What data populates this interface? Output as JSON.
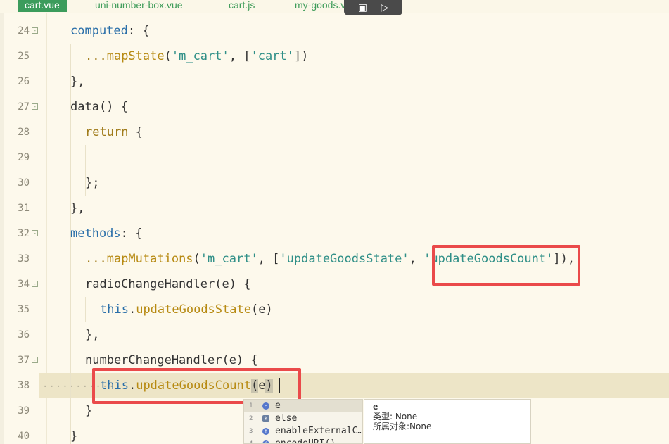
{
  "tabs": [
    {
      "label": "cart.vue",
      "active": true
    },
    {
      "label": "uni-number-box.vue",
      "active": false
    },
    {
      "label": "cart.js",
      "active": false
    },
    {
      "label": "my-goods.v",
      "active": false
    }
  ],
  "overlay_icons": [
    "screen-record-icon",
    "magic-edit-icon"
  ],
  "lines": [
    {
      "n": "24",
      "fold": true
    },
    {
      "n": "25",
      "fold": false
    },
    {
      "n": "26",
      "fold": false
    },
    {
      "n": "27",
      "fold": true
    },
    {
      "n": "28",
      "fold": false
    },
    {
      "n": "29",
      "fold": false
    },
    {
      "n": "30",
      "fold": false
    },
    {
      "n": "31",
      "fold": false
    },
    {
      "n": "32",
      "fold": true
    },
    {
      "n": "33",
      "fold": false
    },
    {
      "n": "34",
      "fold": true
    },
    {
      "n": "35",
      "fold": false
    },
    {
      "n": "36",
      "fold": false
    },
    {
      "n": "37",
      "fold": true
    },
    {
      "n": "38",
      "fold": false
    },
    {
      "n": "39",
      "fold": false
    },
    {
      "n": "40",
      "fold": false
    }
  ],
  "code": {
    "l24": {
      "a": "computed",
      "b": ": {"
    },
    "l25": {
      "a": "...",
      "b": "mapState",
      "c": "(",
      "d": "'m_cart'",
      "e": ", [",
      "f": "'cart'",
      "g": "])"
    },
    "l26": {
      "a": "},"
    },
    "l27": {
      "a": "data",
      "b": "() {"
    },
    "l28": {
      "a": "return",
      "b": " {"
    },
    "l30": {
      "a": "};"
    },
    "l31": {
      "a": "},"
    },
    "l32": {
      "a": "methods",
      "b": ": {"
    },
    "l33": {
      "a": "...",
      "b": "mapMutations",
      "c": "(",
      "d": "'m_cart'",
      "e": ", [",
      "f": "'updateGoodsState'",
      "g": ", ",
      "h": "'updateGoodsCount'",
      "i": "]),"
    },
    "l34": {
      "a": "radioChangeHandler(e) {"
    },
    "l35": {
      "a": "this",
      "b": ".",
      "c": "updateGoodsState",
      "d": "(e)"
    },
    "l36": {
      "a": "},"
    },
    "l37": {
      "a": "numberChangeHandler(e) {"
    },
    "l38": {
      "a": "this",
      "b": ".",
      "c": "updateGoodsCount",
      "d": "(",
      "e": "e",
      "f": ")"
    },
    "l39": {
      "a": "}"
    },
    "l40": {
      "a": "}"
    }
  },
  "autocomplete": {
    "items": [
      {
        "num": "1",
        "label": "e"
      },
      {
        "num": "2",
        "label": "else"
      },
      {
        "num": "3",
        "label": "enableExternalC…"
      },
      {
        "num": "4",
        "label": "encodeURI()"
      }
    ],
    "detail": {
      "name": "e",
      "type_line": "类型: None",
      "owner_line": "所属对象:None"
    }
  },
  "colors": {
    "annotation_red": "#ea4a4a",
    "active_tab": "#3c9c5c",
    "background": "#fdf9ec"
  }
}
